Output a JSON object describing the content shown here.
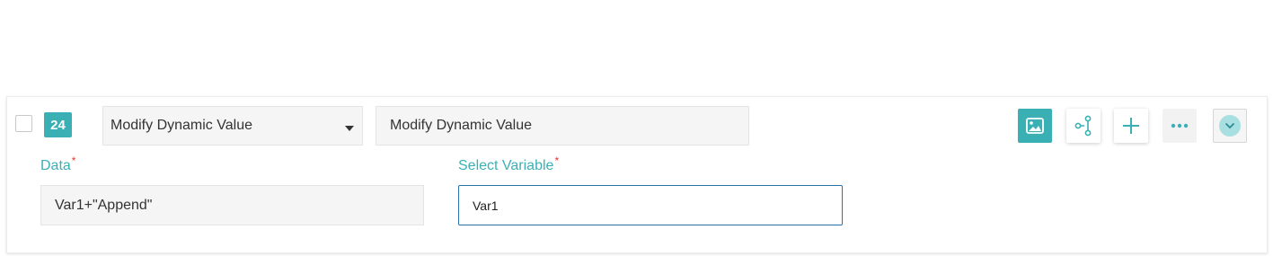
{
  "step": {
    "number": "24",
    "action": "Modify Dynamic Value",
    "description": "Modify Dynamic Value",
    "fields": {
      "data_label": "Data",
      "data_value": "Var1+\"Append\"",
      "variable_label": "Select Variable",
      "variable_value": "Var1",
      "required_mark": "*"
    },
    "toolbar": [
      "image-icon",
      "flow-icon",
      "plus-icon",
      "more-icon",
      "chevron-down-icon"
    ]
  },
  "colors": {
    "accent": "#3ab0b5",
    "required": "#e53935",
    "focus_border": "#2a73a8"
  }
}
